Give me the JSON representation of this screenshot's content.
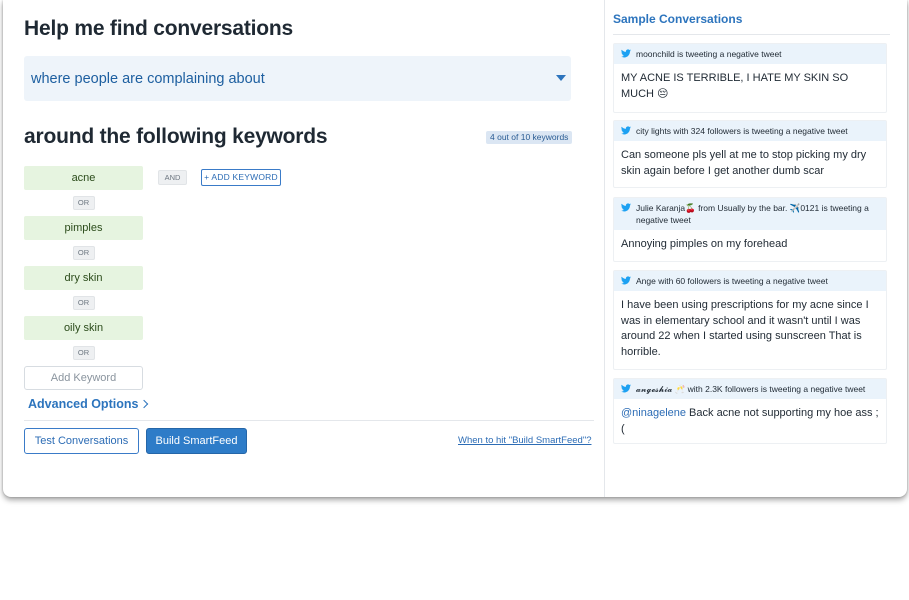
{
  "main": {
    "title": "Help me find conversations",
    "intent_dropdown": {
      "value": "where people are complaining about"
    },
    "keywords_title": "around the following keywords",
    "keyword_count": "4 out of 10 keywords",
    "keywords": [
      {
        "label": "acne"
      },
      {
        "label": "pimples"
      },
      {
        "label": "dry skin"
      },
      {
        "label": "oily skin"
      }
    ],
    "or_label": "OR",
    "and_label": "AND",
    "add_keyword_placeholder": "Add Keyword",
    "add_keyword_button": "+ ADD KEYWORD",
    "advanced_options": "Advanced Options",
    "test_button": "Test Conversations",
    "build_button": "Build SmartFeed",
    "help_link": "When to hit \"Build SmartFeed\"?"
  },
  "sidebar": {
    "title": "Sample Conversations",
    "tweets": [
      {
        "header": "moonchild is tweeting a negative tweet",
        "text": "MY ACNE IS TERRIBLE, I HATE MY SKIN SO MUCH 😔"
      },
      {
        "header": "city lights with 324 followers is tweeting a negative tweet",
        "text": "Can someone pls yell at me to stop picking my dry skin again before I get another dumb scar"
      },
      {
        "header": "Julie Karanja🍒 from Usually by the bar. ✈️0121 is tweeting a negative tweet",
        "text": "Annoying pimples on my forehead"
      },
      {
        "header": "Ange with 60 followers is tweeting a negative tweet",
        "text": "I have been using prescriptions for my acne since I was in elementary school and it wasn't until I was around 22 when I started using sunscreen That is horrible."
      },
      {
        "header": "𝓪𝓷𝓰𝓮𝓼𝓱𝓲𝓪 🥂 with 2.3K followers is tweeting a negative tweet",
        "mention": "@ninagelene",
        "text": " Back acne not supporting my hoe ass ;("
      }
    ]
  },
  "colors": {
    "accent": "#2c74bd",
    "keyword_chip": "#e6f4e0",
    "tweet_header": "#eaf3fb"
  },
  "icons": {
    "tweet_source": "twitter-bird-icon",
    "dropdown": "caret-down-icon",
    "advanced": "chevron-right-icon"
  }
}
